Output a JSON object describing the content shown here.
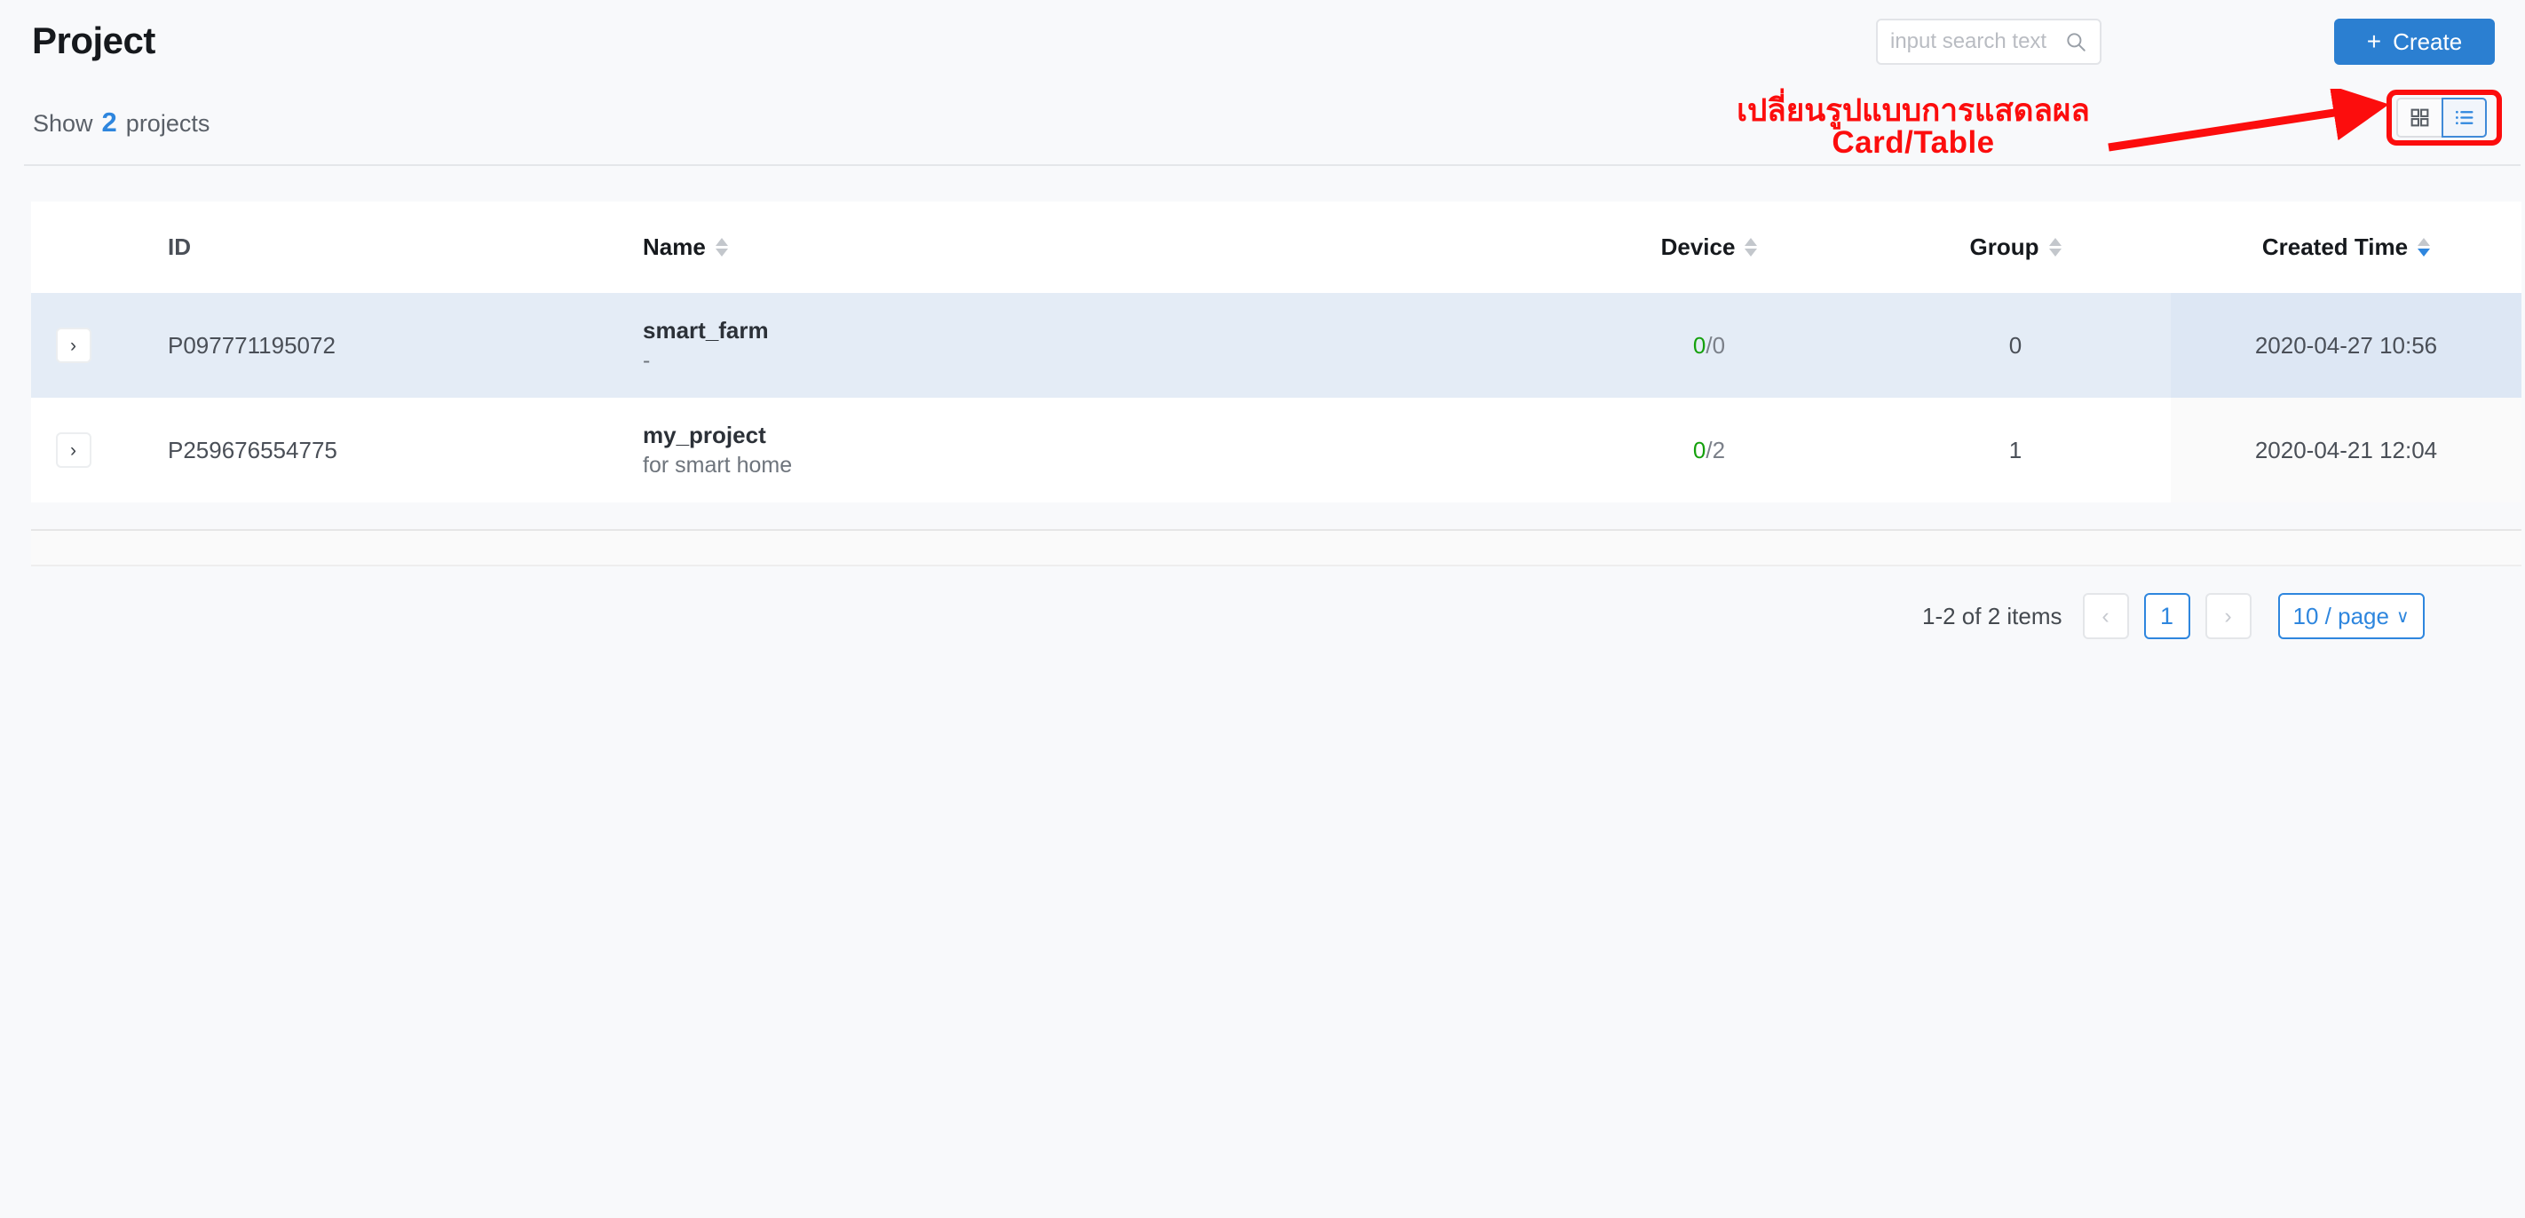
{
  "header": {
    "title": "Project",
    "show_prefix": "Show",
    "show_count": "2",
    "show_suffix": "projects"
  },
  "search": {
    "placeholder": "input search text",
    "value": "",
    "icon": "search-icon"
  },
  "create_button": {
    "label": "Create",
    "plus": "+",
    "color": "#2b7fd1"
  },
  "view_toggle": {
    "card_icon": "grid-icon",
    "table_icon": "list-icon",
    "active": "table",
    "active_color": "#3f8ad8"
  },
  "annotation": {
    "line1": "เปลี่ยนรูปแบบการแสดลผล",
    "line2": "Card/Table",
    "color": "#fc0d0d"
  },
  "table": {
    "columns": [
      {
        "label": "",
        "sortable": false,
        "align": "left"
      },
      {
        "label": "ID",
        "sortable": false,
        "align": "left"
      },
      {
        "label": "Name",
        "sortable": true,
        "align": "left"
      },
      {
        "label": "Device",
        "sortable": true,
        "align": "center"
      },
      {
        "label": "Group",
        "sortable": true,
        "align": "center"
      },
      {
        "label": "Created Time",
        "sortable": true,
        "align": "center",
        "sorted": "desc"
      }
    ],
    "rows": [
      {
        "expand": "›",
        "id": "P097771195072",
        "name": "smart_farm",
        "description": "-",
        "device_online": "0",
        "device_sep": "/",
        "device_total": "0",
        "group": "0",
        "created_time": "2020-04-27 10:56",
        "highlight": true
      },
      {
        "expand": "›",
        "id": "P259676554775",
        "name": "my_project",
        "description": "for smart home",
        "device_online": "0",
        "device_sep": "/",
        "device_total": "2",
        "group": "1",
        "created_time": "2020-04-21 12:04",
        "highlight": false
      }
    ]
  },
  "pagination": {
    "summary": "1-2 of 2 items",
    "prev": "‹",
    "next": "›",
    "current_page": "1",
    "page_size": "10 / page",
    "chevron": "∨",
    "accent": "#2e86de"
  }
}
